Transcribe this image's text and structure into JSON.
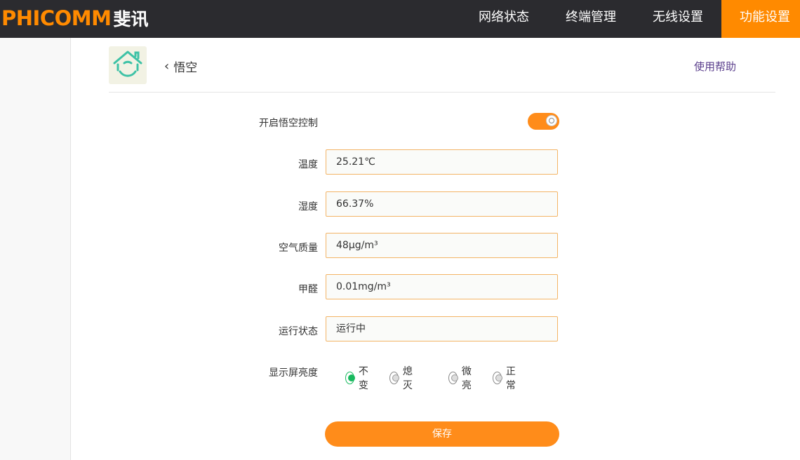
{
  "brand": {
    "logo_text": "PHICOMM",
    "logo_cn": "斐讯"
  },
  "nav": {
    "items": [
      "网络状态",
      "终端管理",
      "无线设置",
      "功能设置"
    ],
    "active": "功能设置"
  },
  "header": {
    "title": "悟空",
    "back_icon": "chevron-left-icon",
    "help_link": "使用帮助",
    "app_icon": "home-recycle-icon"
  },
  "form": {
    "enable_label": "开启悟空控制",
    "enable_on": true,
    "fields": [
      {
        "label": "温度",
        "value": "25.21℃"
      },
      {
        "label": "湿度",
        "value": "66.37%"
      },
      {
        "label": "空气质量",
        "value": "48μg/m³"
      },
      {
        "label": "甲醛",
        "value": "0.01mg/m³"
      },
      {
        "label": "运行状态",
        "value": "运行中"
      }
    ],
    "brightness_label": "显示屏亮度",
    "brightness_options": [
      "不变",
      "熄灭",
      "微亮",
      "正常"
    ],
    "brightness_selected": "不变",
    "save_label": "保存"
  },
  "colors": {
    "accent": "#ff8c1a",
    "topbar": "#2b2b2f",
    "radio_checked": "#18b95e",
    "field_border": "#f3b466"
  }
}
